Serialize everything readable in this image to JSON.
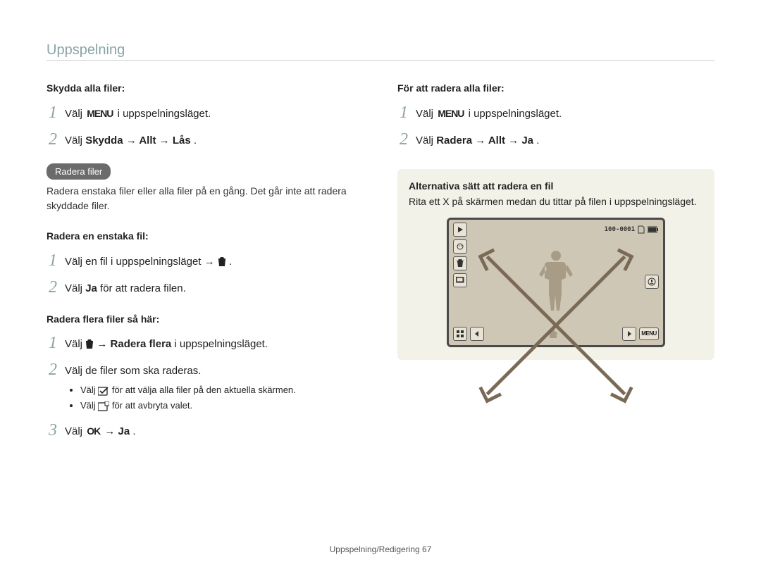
{
  "header": {
    "title": "Uppspelning"
  },
  "left": {
    "protect_all_heading": "Skydda alla filer:",
    "step1_pre": "Välj ",
    "step1_post": " i uppspelningsläget.",
    "step2_pre": "Välj ",
    "step2_bold": "Skydda → Allt → Lås",
    "step2_post": ".",
    "pill": "Radera filer",
    "pill_desc": "Radera enstaka filer eller alla filer på en gång. Det går inte att radera skyddade filer.",
    "single_heading": "Radera en enstaka fil:",
    "single_step1": "Välj en fil i uppspelningsläget → ",
    "single_step1_post": ".",
    "single_step2_pre": "Välj ",
    "single_step2_bold": "Ja",
    "single_step2_post": " för att radera filen.",
    "multi_heading": "Radera flera filer så här:",
    "multi_step1_pre": "Välj ",
    "multi_step1_mid": " → ",
    "multi_step1_bold": "Radera flera",
    "multi_step1_post": " i uppspelningsläget.",
    "multi_step2": "Välj de filer som ska raderas.",
    "multi_bullet1_pre": "Välj ",
    "multi_bullet1_post": " för att välja alla filer på den aktuella skärmen.",
    "multi_bullet2_pre": "Välj ",
    "multi_bullet2_post": " för att avbryta valet.",
    "multi_step3_pre": "Välj ",
    "multi_step3_mid": " → ",
    "multi_step3_bold": "Ja",
    "multi_step3_post": "."
  },
  "right": {
    "all_heading": "För att radera alla filer:",
    "step1_pre": "Välj ",
    "step1_post": " i uppspelningsläget.",
    "step2_pre": "Välj ",
    "step2_bold": "Radera → Allt → Ja",
    "step2_post": ".",
    "note_title": "Alternativa sätt att radera en fil",
    "note_text": "Rita ett X på skärmen medan du tittar på filen i uppspelningsläget.",
    "camera": {
      "counter": "100-0001",
      "menu_label": "MENU"
    }
  },
  "icons": {
    "menu_text": "MENU",
    "ok_text": "OK"
  },
  "footer": {
    "text": "Uppspelning/Redigering  67"
  }
}
